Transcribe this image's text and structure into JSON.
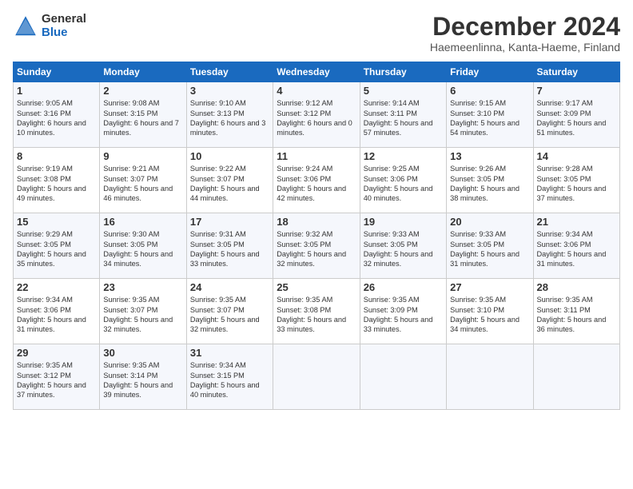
{
  "logo": {
    "general": "General",
    "blue": "Blue"
  },
  "title": "December 2024",
  "location": "Haemeenlinna, Kanta-Haeme, Finland",
  "headers": [
    "Sunday",
    "Monday",
    "Tuesday",
    "Wednesday",
    "Thursday",
    "Friday",
    "Saturday"
  ],
  "weeks": [
    [
      {
        "day": "1",
        "sunrise": "9:05 AM",
        "sunset": "3:16 PM",
        "daylight": "6 hours and 10 minutes."
      },
      {
        "day": "2",
        "sunrise": "9:08 AM",
        "sunset": "3:15 PM",
        "daylight": "6 hours and 7 minutes."
      },
      {
        "day": "3",
        "sunrise": "9:10 AM",
        "sunset": "3:13 PM",
        "daylight": "6 hours and 3 minutes."
      },
      {
        "day": "4",
        "sunrise": "9:12 AM",
        "sunset": "3:12 PM",
        "daylight": "6 hours and 0 minutes."
      },
      {
        "day": "5",
        "sunrise": "9:14 AM",
        "sunset": "3:11 PM",
        "daylight": "5 hours and 57 minutes."
      },
      {
        "day": "6",
        "sunrise": "9:15 AM",
        "sunset": "3:10 PM",
        "daylight": "5 hours and 54 minutes."
      },
      {
        "day": "7",
        "sunrise": "9:17 AM",
        "sunset": "3:09 PM",
        "daylight": "5 hours and 51 minutes."
      }
    ],
    [
      {
        "day": "8",
        "sunrise": "9:19 AM",
        "sunset": "3:08 PM",
        "daylight": "5 hours and 49 minutes."
      },
      {
        "day": "9",
        "sunrise": "9:21 AM",
        "sunset": "3:07 PM",
        "daylight": "5 hours and 46 minutes."
      },
      {
        "day": "10",
        "sunrise": "9:22 AM",
        "sunset": "3:07 PM",
        "daylight": "5 hours and 44 minutes."
      },
      {
        "day": "11",
        "sunrise": "9:24 AM",
        "sunset": "3:06 PM",
        "daylight": "5 hours and 42 minutes."
      },
      {
        "day": "12",
        "sunrise": "9:25 AM",
        "sunset": "3:06 PM",
        "daylight": "5 hours and 40 minutes."
      },
      {
        "day": "13",
        "sunrise": "9:26 AM",
        "sunset": "3:05 PM",
        "daylight": "5 hours and 38 minutes."
      },
      {
        "day": "14",
        "sunrise": "9:28 AM",
        "sunset": "3:05 PM",
        "daylight": "5 hours and 37 minutes."
      }
    ],
    [
      {
        "day": "15",
        "sunrise": "9:29 AM",
        "sunset": "3:05 PM",
        "daylight": "5 hours and 35 minutes."
      },
      {
        "day": "16",
        "sunrise": "9:30 AM",
        "sunset": "3:05 PM",
        "daylight": "5 hours and 34 minutes."
      },
      {
        "day": "17",
        "sunrise": "9:31 AM",
        "sunset": "3:05 PM",
        "daylight": "5 hours and 33 minutes."
      },
      {
        "day": "18",
        "sunrise": "9:32 AM",
        "sunset": "3:05 PM",
        "daylight": "5 hours and 32 minutes."
      },
      {
        "day": "19",
        "sunrise": "9:33 AM",
        "sunset": "3:05 PM",
        "daylight": "5 hours and 32 minutes."
      },
      {
        "day": "20",
        "sunrise": "9:33 AM",
        "sunset": "3:05 PM",
        "daylight": "5 hours and 31 minutes."
      },
      {
        "day": "21",
        "sunrise": "9:34 AM",
        "sunset": "3:06 PM",
        "daylight": "5 hours and 31 minutes."
      }
    ],
    [
      {
        "day": "22",
        "sunrise": "9:34 AM",
        "sunset": "3:06 PM",
        "daylight": "5 hours and 31 minutes."
      },
      {
        "day": "23",
        "sunrise": "9:35 AM",
        "sunset": "3:07 PM",
        "daylight": "5 hours and 32 minutes."
      },
      {
        "day": "24",
        "sunrise": "9:35 AM",
        "sunset": "3:07 PM",
        "daylight": "5 hours and 32 minutes."
      },
      {
        "day": "25",
        "sunrise": "9:35 AM",
        "sunset": "3:08 PM",
        "daylight": "5 hours and 33 minutes."
      },
      {
        "day": "26",
        "sunrise": "9:35 AM",
        "sunset": "3:09 PM",
        "daylight": "5 hours and 33 minutes."
      },
      {
        "day": "27",
        "sunrise": "9:35 AM",
        "sunset": "3:10 PM",
        "daylight": "5 hours and 34 minutes."
      },
      {
        "day": "28",
        "sunrise": "9:35 AM",
        "sunset": "3:11 PM",
        "daylight": "5 hours and 36 minutes."
      }
    ],
    [
      {
        "day": "29",
        "sunrise": "9:35 AM",
        "sunset": "3:12 PM",
        "daylight": "5 hours and 37 minutes."
      },
      {
        "day": "30",
        "sunrise": "9:35 AM",
        "sunset": "3:14 PM",
        "daylight": "5 hours and 39 minutes."
      },
      {
        "day": "31",
        "sunrise": "9:34 AM",
        "sunset": "3:15 PM",
        "daylight": "5 hours and 40 minutes."
      },
      null,
      null,
      null,
      null
    ]
  ]
}
